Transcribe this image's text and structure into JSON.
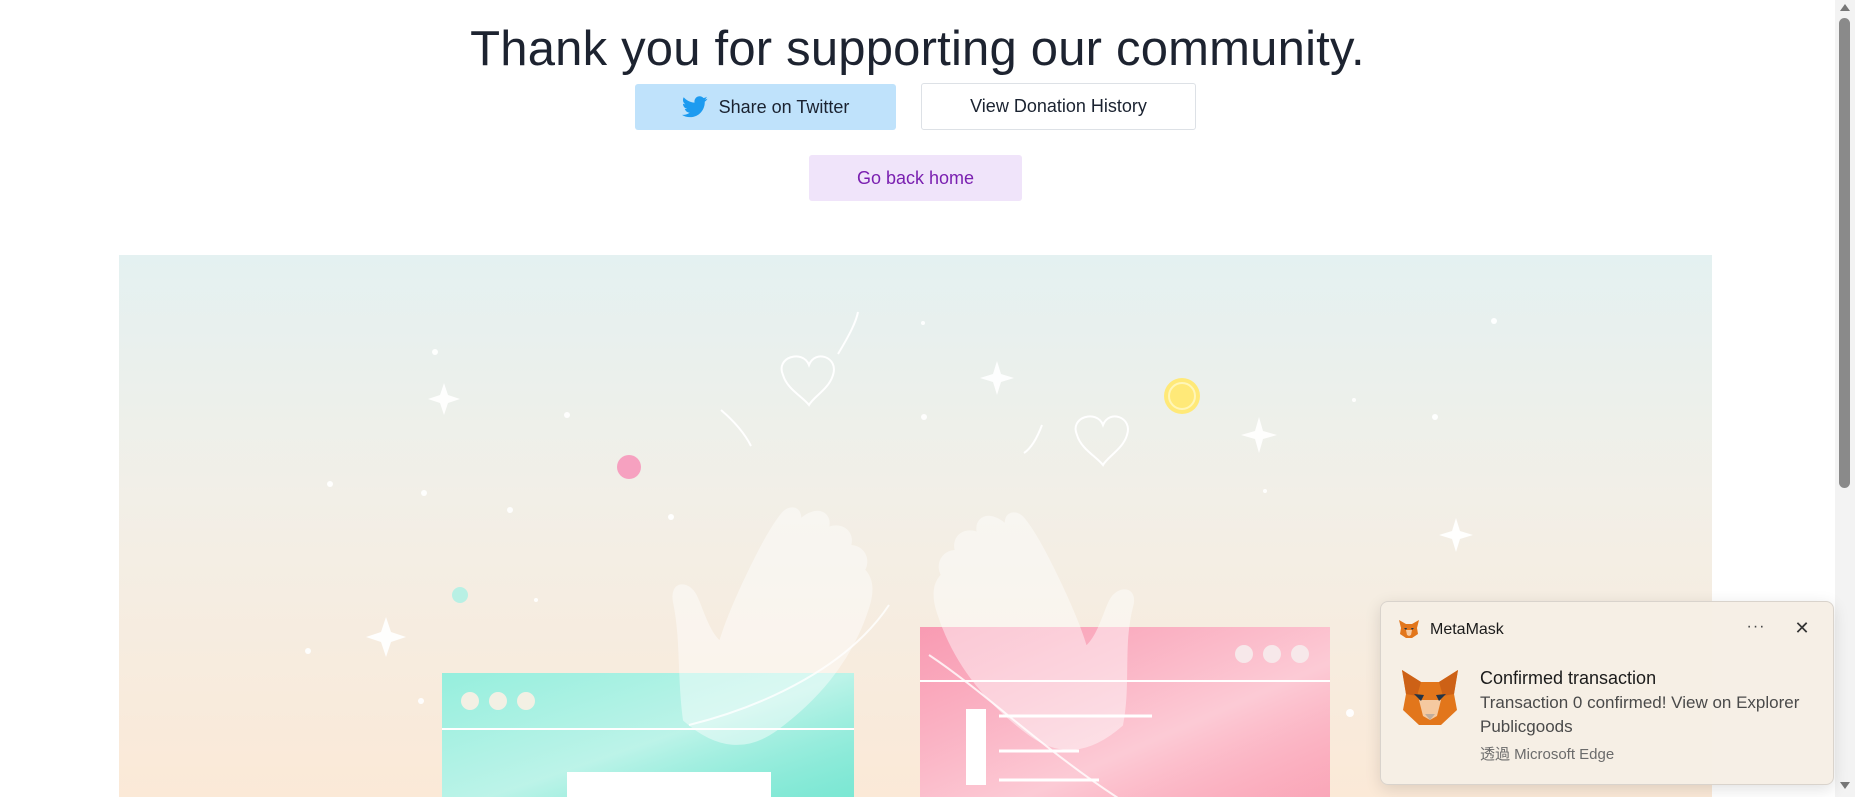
{
  "page": {
    "title": "Thank you for supporting our community."
  },
  "actions": {
    "share_twitter_label": "Share on Twitter",
    "view_history_label": "View Donation History",
    "go_home_label": "Go back home"
  },
  "colors": {
    "twitter_button_bg": "#bfe2fb",
    "twitter_blue": "#1d9bf0",
    "home_button_bg": "#f0e4fa",
    "home_button_text": "#7a1fb0",
    "left_window": "#7de8d4",
    "right_window": "#fba7b9"
  },
  "notification": {
    "app_name": "MetaMask",
    "more_label": "···",
    "close_label": "✕",
    "title": "Confirmed transaction",
    "message": "Transaction 0 confirmed! View on Explorer",
    "site": "Publicgoods",
    "via": "透過 Microsoft Edge",
    "app_icon": "metamask-fox-icon"
  }
}
